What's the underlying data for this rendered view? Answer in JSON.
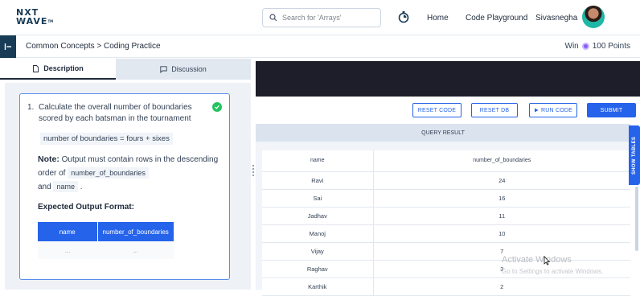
{
  "navbar": {
    "logo_line1": "NXT",
    "logo_line2": "WAVE",
    "logo_tm": "TM",
    "search_placeholder": "Search for 'Arrays'",
    "links": [
      "Home",
      "Code Playground"
    ],
    "username": "Sivasnegha"
  },
  "subheader": {
    "breadcrumb": "Common Concepts > Coding Practice",
    "win_label": "Win",
    "points": "100 Points"
  },
  "tabs": [
    "Description",
    "Discussion"
  ],
  "question": {
    "number": "1.",
    "text": "Calculate the overall number of boundaries scored by each batsman in the tournament",
    "formula": "number of boundaries = fours + sixes",
    "note_label": "Note:",
    "note_text_1": "Output must contain rows in the descending order of",
    "note_code_1": "number_of_boundaries",
    "note_and": "and",
    "note_code_2": "name",
    "note_end": ".",
    "expected_title": "Expected Output Format:",
    "expected_columns": [
      "name",
      "number_of_boundaries"
    ],
    "expected_row": [
      "...",
      "..."
    ]
  },
  "actions": {
    "reset_code": "RESET CODE",
    "reset_db": "RESET DB",
    "run_code": "RUN CODE",
    "submit": "SUBMIT"
  },
  "result": {
    "title": "QUERY RESULT",
    "columns": [
      "name",
      "number_of_boundaries"
    ],
    "rows": [
      [
        "Ravi",
        "24"
      ],
      [
        "Sai",
        "16"
      ],
      [
        "Jadhav",
        "11"
      ],
      [
        "Manoj",
        "10"
      ],
      [
        "Vijay",
        "7"
      ],
      [
        "Raghav",
        "3"
      ],
      [
        "Karthik",
        "2"
      ]
    ],
    "show_tables": "SHOW TABLES"
  },
  "watermark": {
    "title": "Activate Windows",
    "subtitle": "Go to Settings to activate Windows."
  },
  "colors": {
    "accent": "#2563eb",
    "navy": "#183b56",
    "success": "#22c55e"
  }
}
